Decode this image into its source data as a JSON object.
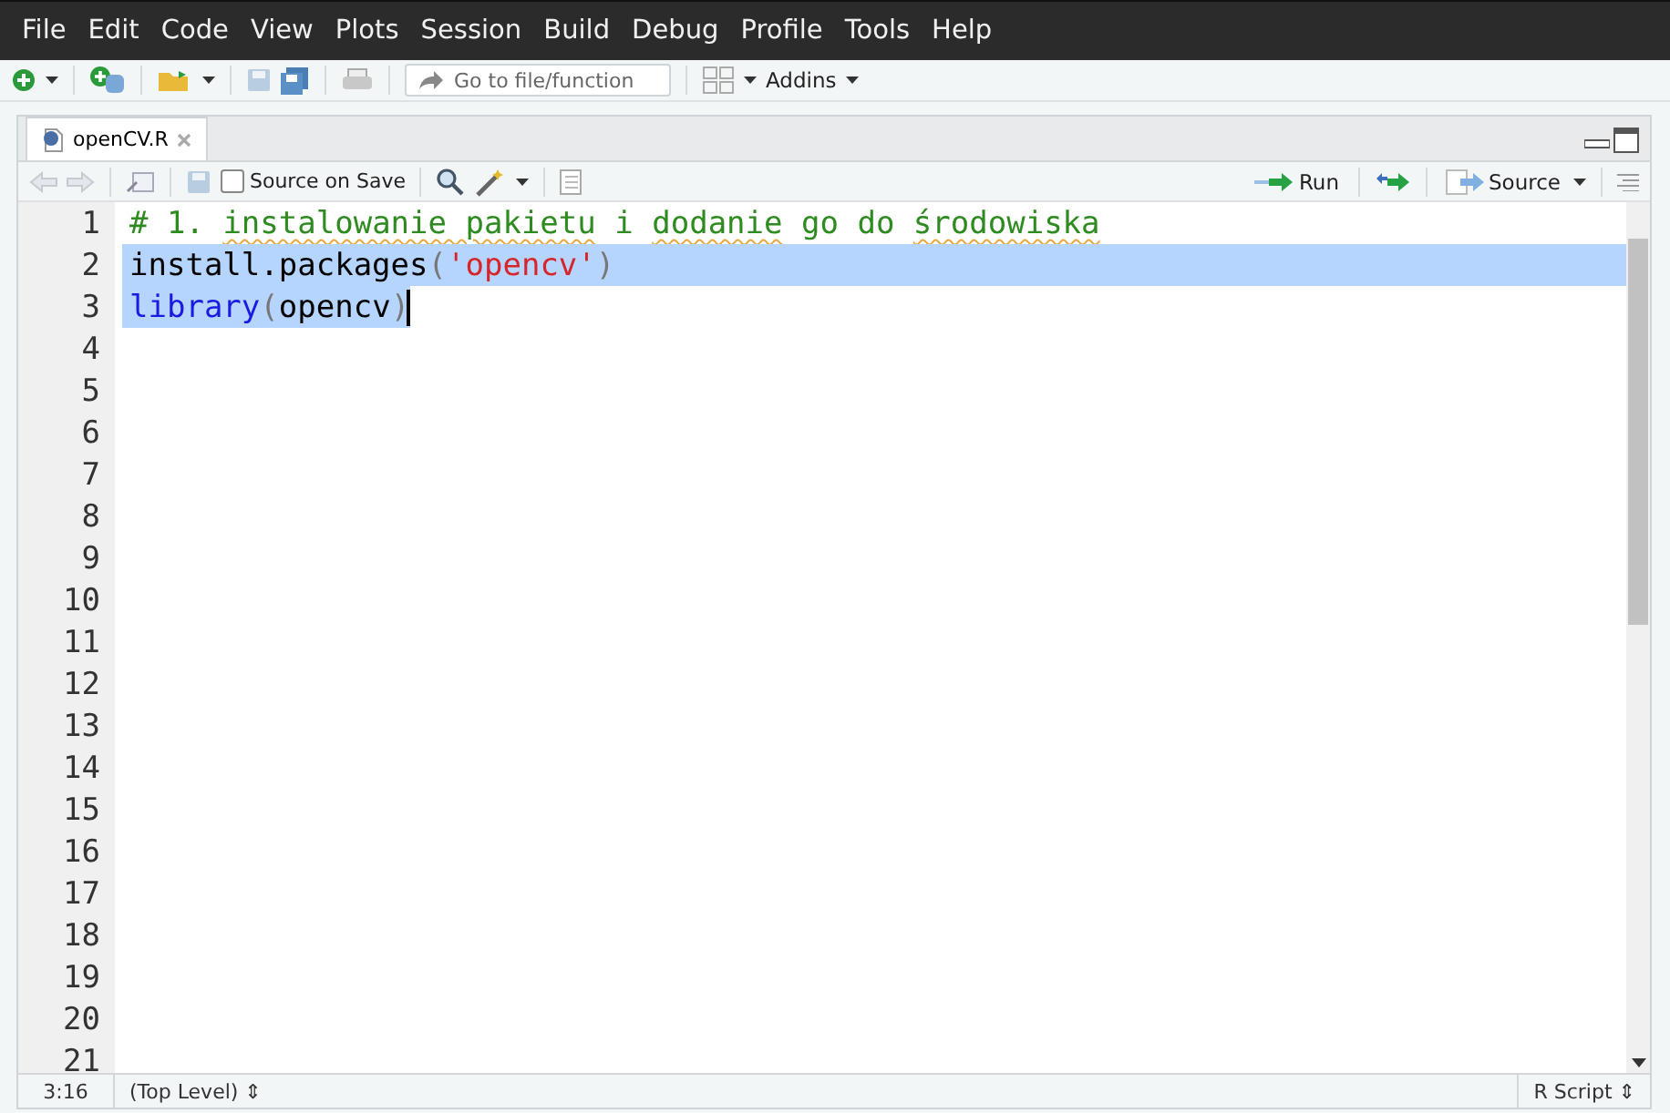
{
  "menu": [
    "File",
    "Edit",
    "Code",
    "View",
    "Plots",
    "Session",
    "Build",
    "Debug",
    "Profile",
    "Tools",
    "Help"
  ],
  "toolbar": {
    "goto_placeholder": "Go to file/function",
    "addins": "Addins"
  },
  "tabs": [
    {
      "label": "openCV.R",
      "selected": true
    }
  ],
  "editor_toolbar": {
    "source_on_save": {
      "label": "Source on Save",
      "checked": false
    },
    "run": "Run",
    "source": "Source"
  },
  "lines": [
    {
      "number": "1",
      "selected": false,
      "tokens": [
        {
          "kind": "comment",
          "text": "# 1. ",
          "misspelled": false
        },
        {
          "kind": "comment",
          "text": "instalowanie pakietu",
          "misspelled": true
        },
        {
          "kind": "comment",
          "text": " i ",
          "misspelled": false
        },
        {
          "kind": "comment",
          "text": "dodanie",
          "misspelled": true
        },
        {
          "kind": "comment",
          "text": " go do ",
          "misspelled": false
        },
        {
          "kind": "comment",
          "text": "środowiska",
          "misspelled": true
        }
      ]
    },
    {
      "number": "2",
      "selected": true,
      "tokens": [
        {
          "kind": "plain",
          "text": "install.packages"
        },
        {
          "kind": "paren",
          "text": "("
        },
        {
          "kind": "string",
          "text": "'opencv'"
        },
        {
          "kind": "paren",
          "text": ")"
        }
      ]
    },
    {
      "number": "3",
      "selected": true,
      "tokens": [
        {
          "kind": "function",
          "text": "library"
        },
        {
          "kind": "paren",
          "text": "("
        },
        {
          "kind": "plain",
          "text": "opencv"
        },
        {
          "kind": "paren",
          "text": ")"
        }
      ],
      "cursor": true
    },
    {
      "number": "4",
      "selected": false
    },
    {
      "number": "5",
      "selected": false
    },
    {
      "number": "6",
      "selected": false
    },
    {
      "number": "7",
      "selected": false
    },
    {
      "number": "8",
      "selected": false
    },
    {
      "number": "9",
      "selected": false
    },
    {
      "number": "10",
      "selected": false
    },
    {
      "number": "11",
      "selected": false
    },
    {
      "number": "12",
      "selected": false
    },
    {
      "number": "13",
      "selected": false
    },
    {
      "number": "14",
      "selected": false
    },
    {
      "number": "15",
      "selected": false
    },
    {
      "number": "16",
      "selected": false
    },
    {
      "number": "17",
      "selected": false
    },
    {
      "number": "18",
      "selected": false
    },
    {
      "number": "19",
      "selected": false
    },
    {
      "number": "20",
      "selected": false
    },
    {
      "number": "21",
      "selected": false
    }
  ],
  "status_bar": {
    "position": "3:16",
    "scope": "(Top Level) ⇕",
    "file_type": "R Script ⇕"
  }
}
